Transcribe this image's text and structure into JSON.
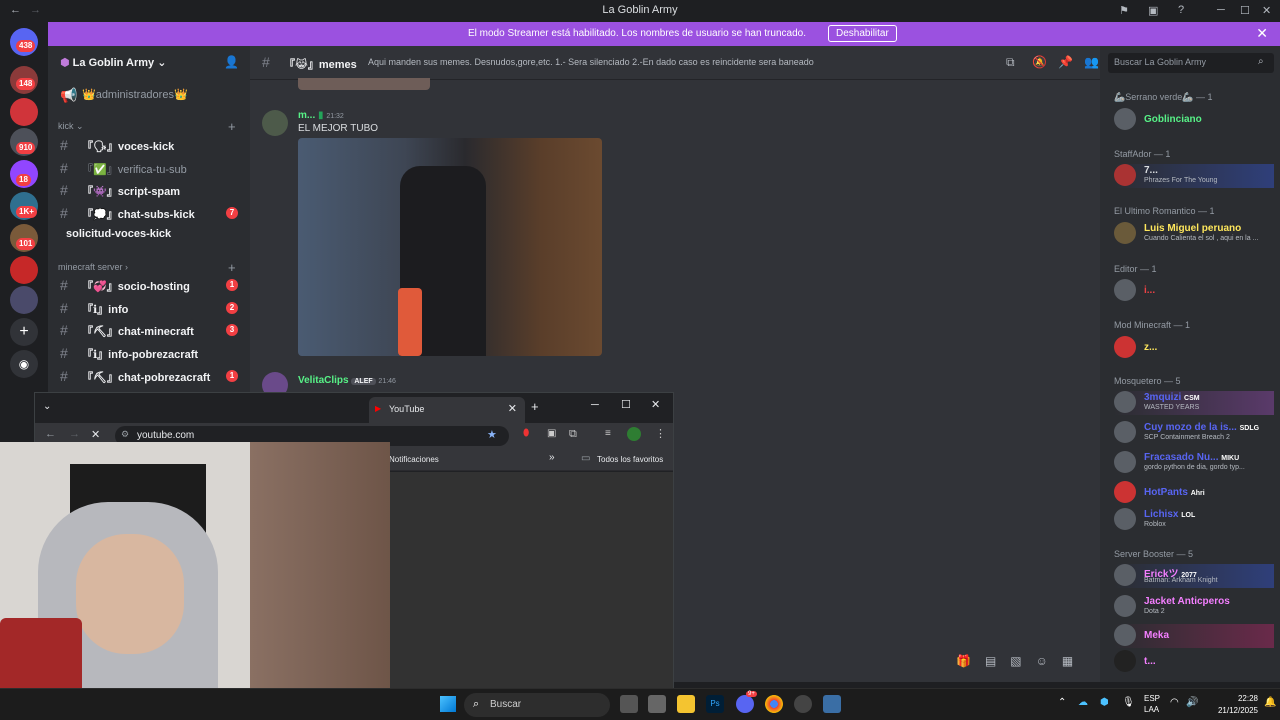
{
  "window": {
    "title": "La Goblin Army"
  },
  "banner": {
    "message": "El modo Streamer está habilitado. Los nombres de usuario se han truncado.",
    "button_label": "Deshabilitar"
  },
  "guild_badges": [
    "438",
    "148",
    "910",
    "18",
    "1K+",
    "101"
  ],
  "sidebar": {
    "server_name": "La Goblin Army",
    "top_item": "👑administradores👑",
    "categories": [
      {
        "label": "kick"
      },
      {
        "label": "minecraft server"
      }
    ],
    "kick_channels": [
      {
        "name": "『🗣』voces-kick",
        "count": ""
      },
      {
        "name": "『✅』verifica-tu-sub",
        "count": ""
      },
      {
        "name": "『👾』script-spam",
        "count": ""
      },
      {
        "name": "『💭』chat-subs-kick",
        "count": "7"
      },
      {
        "name": "solicitud-voces-kick",
        "count": ""
      }
    ],
    "mc_channels": [
      {
        "name": "『💞』socio-hosting",
        "count": "1"
      },
      {
        "name": "『ℹ』info",
        "count": "2"
      },
      {
        "name": "『⛏』chat-minecraft",
        "count": "3"
      },
      {
        "name": "『ℹ』info-pobrezacraft",
        "count": ""
      },
      {
        "name": "『⛏』chat-pobrezacraft",
        "count": "1"
      }
    ]
  },
  "chat": {
    "channel_name": "『😹』memes",
    "topic": "Aqui manden sus memes. Desnudos,gore,etc. 1.- Sera silenciado 2.-En dado caso es reincidente sera baneado",
    "messages": [
      {
        "author": "m...",
        "time": "21:32",
        "text": "EL MEJOR TUBO"
      },
      {
        "author": "VelitaClips",
        "tag": "ALEF",
        "time": "21:46",
        "text": ""
      }
    ]
  },
  "members": {
    "search_placeholder": "Buscar La Goblin Army",
    "groups": [
      {
        "title": "🦾Serrano verde🦾 — 1",
        "members": [
          {
            "name": "Goblinciano",
            "status": "",
            "color": "#57f287"
          }
        ]
      },
      {
        "title": "StaffAdor — 1",
        "members": [
          {
            "name": "7...",
            "status": "Phrazes For The Young",
            "color": "#f2f3f5"
          }
        ]
      },
      {
        "title": "El Ultimo Romantico — 1",
        "members": [
          {
            "name": "Luis Miguel peruano",
            "status": "Cuando Calienta el sol , aqui en la ...",
            "color": "#fee75c"
          }
        ]
      },
      {
        "title": "Editor — 1",
        "members": [
          {
            "name": "i...",
            "status": "",
            "color": "#ed4245"
          }
        ]
      },
      {
        "title": "Mod Minecraft — 1",
        "members": [
          {
            "name": "z...",
            "status": "",
            "color": "#fee75c"
          }
        ]
      },
      {
        "title": "Mosquetero — 5",
        "members": [
          {
            "name": "3mquizi",
            "tag": "CSM",
            "status": "WASTED YEARS",
            "color": "#5865f2"
          },
          {
            "name": "Cuy mozo de la is...",
            "tag": "SDLG",
            "status": "SCP Containment Breach 2",
            "color": "#5865f2"
          },
          {
            "name": "Fracasado Nu...",
            "tag": "MIKU",
            "status": "gordo python de dia, gordo typ...",
            "color": "#5865f2"
          },
          {
            "name": "HotPants",
            "tag": "Ahri",
            "status": "",
            "color": "#5865f2"
          },
          {
            "name": "Lichisx",
            "tag": "LOL",
            "status": "Roblox",
            "color": "#5865f2"
          }
        ]
      },
      {
        "title": "Server Booster — 5",
        "members": [
          {
            "name": "Erickツ",
            "tag": "2077",
            "status": "Batman: Arkham Knight",
            "color": "#f47fff"
          },
          {
            "name": "Jacket Anticperos",
            "tag": "",
            "status": "Dota 2",
            "color": "#f47fff"
          },
          {
            "name": "Meka",
            "tag": "",
            "status": "",
            "color": "#f47fff"
          },
          {
            "name": "t...",
            "tag": "",
            "status": "",
            "color": "#f47fff"
          }
        ]
      }
    ]
  },
  "browser": {
    "tab_title": "YouTube",
    "url": "youtube.com",
    "bookmark_item": "Notificaciones",
    "all_bookmarks": "Todos los favoritos"
  },
  "taskbar": {
    "search_label": "Buscar",
    "lang": "ESP",
    "lang2": "LAA",
    "time": "22:28",
    "date": "21/12/2025",
    "discord_badge": "9+"
  }
}
